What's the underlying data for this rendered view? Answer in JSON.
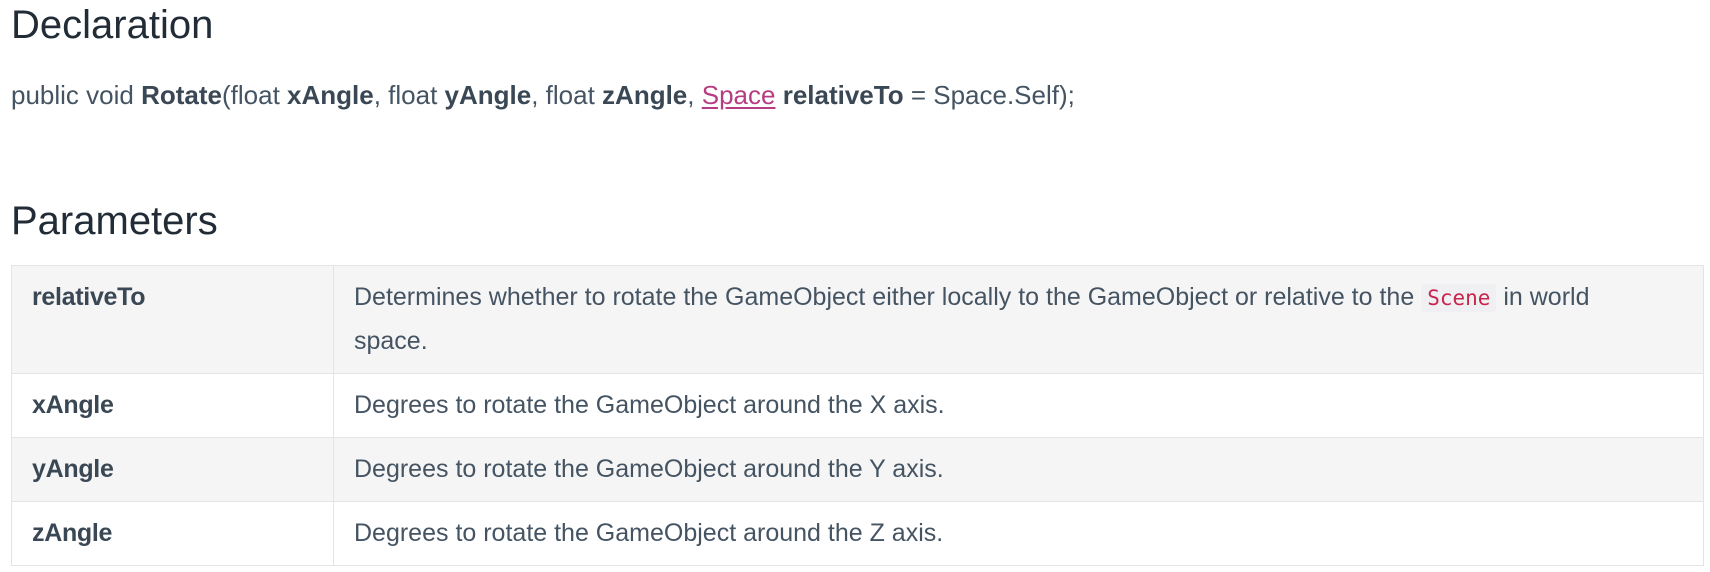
{
  "declaration": {
    "heading": "Declaration",
    "signature": {
      "prefix": "public void ",
      "method": "Rotate",
      "open": "(float ",
      "p1": "xAngle",
      "sep1": ", float ",
      "p2": "yAngle",
      "sep2": ", float ",
      "p3": "zAngle",
      "sep3": ", ",
      "type_link": "Space",
      "space_after_type": " ",
      "p4": "relativeTo",
      "default": " = Space.Self);"
    }
  },
  "parameters": {
    "heading": "Parameters",
    "rows": [
      {
        "name": "relativeTo",
        "desc_before": "Determines whether to rotate the GameObject either locally to the GameObject or relative to the ",
        "code": "Scene",
        "desc_after": " in world space."
      },
      {
        "name": "xAngle",
        "desc": "Degrees to rotate the GameObject around the X axis."
      },
      {
        "name": "yAngle",
        "desc": "Degrees to rotate the GameObject around the Y axis."
      },
      {
        "name": "zAngle",
        "desc": "Degrees to rotate the GameObject around the Z axis."
      }
    ]
  },
  "colors": {
    "heading": "#222c37",
    "text": "#455463",
    "link": "#b83c82",
    "code_text": "#c7254e",
    "row_shade": "#f5f5f5",
    "border": "#e2e5e8"
  }
}
